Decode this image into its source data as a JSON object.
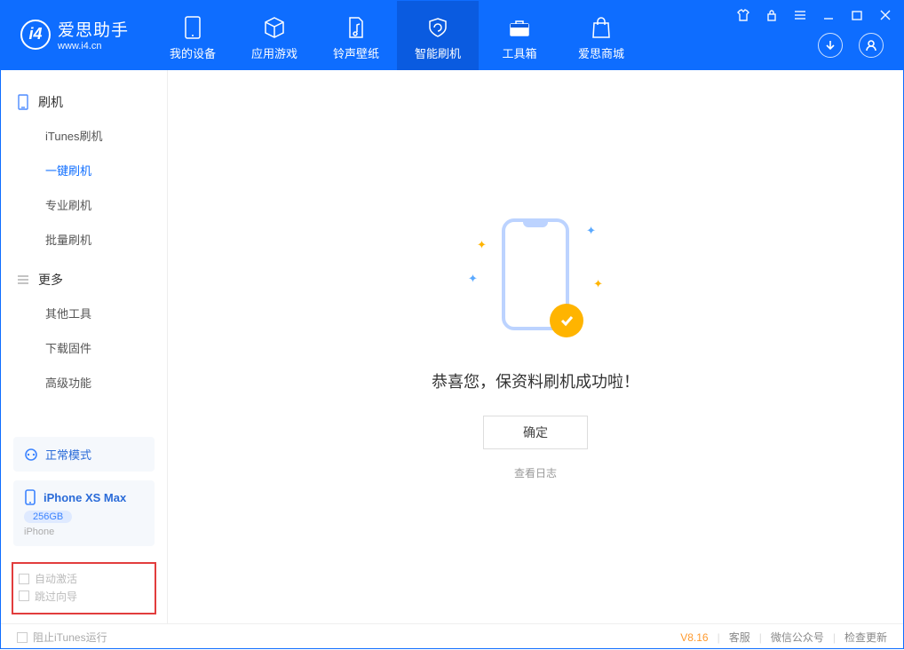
{
  "app": {
    "name_cn": "爱思助手",
    "name_en": "www.i4.cn"
  },
  "tabs": [
    {
      "label": "我的设备"
    },
    {
      "label": "应用游戏"
    },
    {
      "label": "铃声壁纸"
    },
    {
      "label": "智能刷机"
    },
    {
      "label": "工具箱"
    },
    {
      "label": "爱思商城"
    }
  ],
  "sidebar": {
    "section1_title": "刷机",
    "items1": [
      {
        "label": "iTunes刷机"
      },
      {
        "label": "一键刷机"
      },
      {
        "label": "专业刷机"
      },
      {
        "label": "批量刷机"
      }
    ],
    "section2_title": "更多",
    "items2": [
      {
        "label": "其他工具"
      },
      {
        "label": "下载固件"
      },
      {
        "label": "高级功能"
      }
    ]
  },
  "device": {
    "mode_label": "正常模式",
    "model": "iPhone XS Max",
    "storage": "256GB",
    "type": "iPhone"
  },
  "options": {
    "auto_activate": "自动激活",
    "skip_guide": "跳过向导"
  },
  "main": {
    "success_msg": "恭喜您，保资料刷机成功啦！",
    "ok_btn": "确定",
    "view_log": "查看日志"
  },
  "footer": {
    "block_itunes": "阻止iTunes运行",
    "version": "V8.16",
    "link1": "客服",
    "link2": "微信公众号",
    "link3": "检查更新"
  }
}
